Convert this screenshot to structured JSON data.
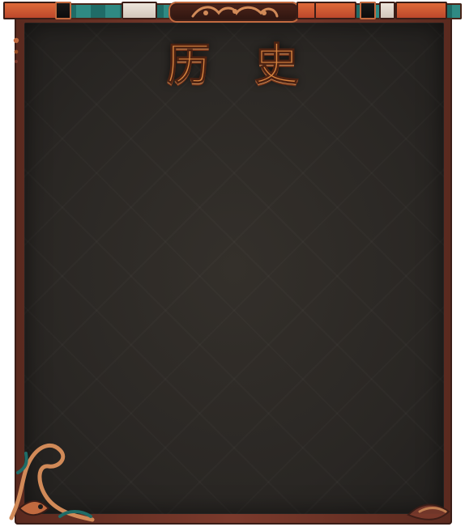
{
  "title": "历 史",
  "colors": {
    "frame_brown": "#5a2a1f",
    "panel_charcoal": "#2a2724",
    "title_orange": "#d7833f",
    "accent_teal": "#1f6c67",
    "accent_orange": "#e36d3a"
  },
  "decor": {
    "top_band_icon_names": [
      "fan-icon",
      "cloud-pattern-icon",
      "knot-icon"
    ],
    "corner_icon_names": [
      "fish-icon",
      "swirl-icon",
      "lotus-icon"
    ]
  }
}
